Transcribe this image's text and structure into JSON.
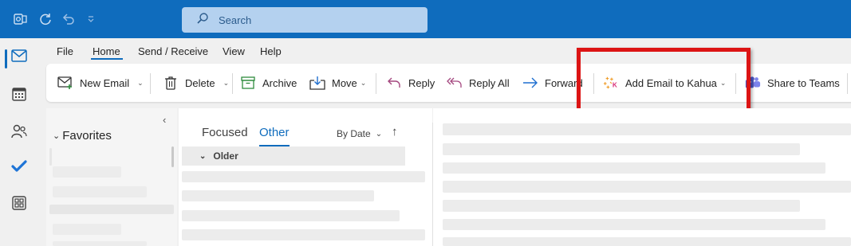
{
  "titlebar": {
    "search_placeholder": "Search",
    "icons": [
      "outlook-icon",
      "sync-icon",
      "undo-icon",
      "customize-qat-icon"
    ],
    "background": "#0f6cbd"
  },
  "rail": {
    "items": [
      "mail-icon",
      "calendar-icon",
      "people-icon",
      "todo-icon",
      "apps-icon"
    ],
    "active": "mail-icon"
  },
  "menu": {
    "tabs": [
      "File",
      "Home",
      "Send / Receive",
      "View",
      "Help"
    ],
    "active_tab": "Home"
  },
  "ribbon": {
    "new_email": "New Email",
    "delete": "Delete",
    "archive": "Archive",
    "move": "Move",
    "reply": "Reply",
    "reply_all": "Reply All",
    "forward": "Forward",
    "add_email_to_kahua": "Add Email to Kahua",
    "share_to_teams": "Share to Teams"
  },
  "folder_pane": {
    "favorites": "Favorites"
  },
  "message_list": {
    "tab_focused": "Focused",
    "tab_other": "Other",
    "active_tab": "Other",
    "sort_by": "By Date",
    "group_header": "Older"
  },
  "highlight_color": "#dc1414"
}
